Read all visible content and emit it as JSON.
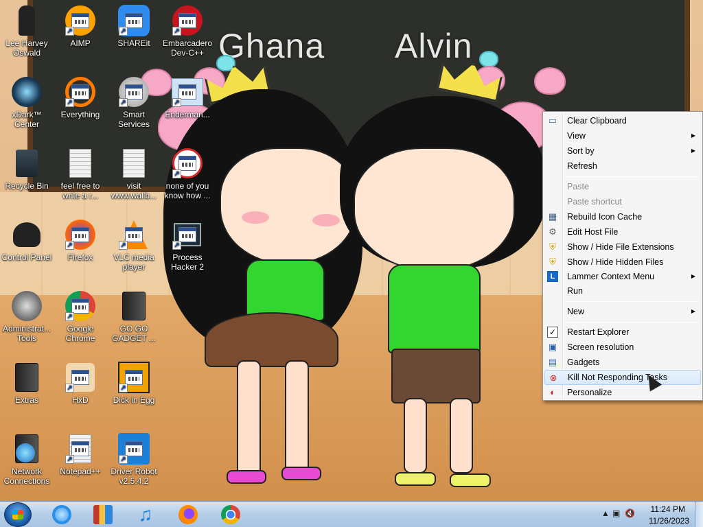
{
  "wallpaper": {
    "left_name": "Ghana",
    "right_name": "Alvin"
  },
  "desktop_icons": [
    {
      "label": "Lee Harvey Oswald",
      "icon": "character-icon"
    },
    {
      "label": "AIMP",
      "icon": "aimp-icon"
    },
    {
      "label": "SHAREit",
      "icon": "shareit-icon"
    },
    {
      "label": "Embarcadero Dev-C++",
      "icon": "devcpp-icon"
    },
    {
      "label": "xDark™ Center",
      "icon": "xdark-icon"
    },
    {
      "label": "Everything",
      "icon": "everything-icon"
    },
    {
      "label": "Smart Services",
      "icon": "smart-services-icon"
    },
    {
      "label": "Enderman...",
      "icon": "enderman-icon"
    },
    {
      "label": "Recycle Bin",
      "icon": "recycle-bin-icon"
    },
    {
      "label": "feel free to write a r...",
      "icon": "text-document-icon"
    },
    {
      "label": "visit www.wallb...",
      "icon": "text-document-icon"
    },
    {
      "label": "none of you know how ...",
      "icon": "shortcut-icon"
    },
    {
      "label": "Control Panel",
      "icon": "control-panel-icon"
    },
    {
      "label": "Firefox",
      "icon": "firefox-icon"
    },
    {
      "label": "VLC media player",
      "icon": "vlc-icon"
    },
    {
      "label": "Process Hacker 2",
      "icon": "process-hacker-icon"
    },
    {
      "label": "Administrat... Tools",
      "icon": "admin-tools-icon"
    },
    {
      "label": "Google Chrome",
      "icon": "chrome-icon"
    },
    {
      "label": "GO GO GADGET ...",
      "icon": "folder-icon"
    },
    {
      "label": "Extras",
      "icon": "folder-icon"
    },
    {
      "label": "HxD",
      "icon": "hxd-icon"
    },
    {
      "label": "Dick in Egg",
      "icon": "dick-in-egg-icon"
    },
    {
      "label": "Network Connections",
      "icon": "network-icon"
    },
    {
      "label": "Notepad++",
      "icon": "notepadpp-icon"
    },
    {
      "label": "Driver Robot v2.5.4.2",
      "icon": "driver-robot-icon"
    }
  ],
  "context_menu": {
    "items": [
      {
        "label": "Clear Clipboard",
        "icon": "clipboard-icon"
      },
      {
        "label": "View",
        "submenu": true
      },
      {
        "label": "Sort by",
        "submenu": true
      },
      {
        "label": "Refresh"
      },
      {
        "label": "Paste",
        "disabled": true
      },
      {
        "label": "Paste shortcut",
        "disabled": true
      },
      {
        "label": "Rebuild Icon Cache",
        "icon": "rebuild-cache-icon"
      },
      {
        "label": "Edit Host File",
        "icon": "gear-icon"
      },
      {
        "label": "Show / Hide File Extensions",
        "icon": "shield-icon"
      },
      {
        "label": "Show / Hide Hidden Files",
        "icon": "shield-icon"
      },
      {
        "label": "Lammer Context Menu",
        "icon": "lammer-icon",
        "submenu": true
      },
      {
        "label": "Run"
      },
      {
        "label": "New",
        "submenu": true
      },
      {
        "label": "Restart Explorer",
        "icon": "checkmark-icon"
      },
      {
        "label": "Screen resolution",
        "icon": "monitor-icon"
      },
      {
        "label": "Gadgets",
        "icon": "gadgets-icon"
      },
      {
        "label": "Kill Not Responding Tasks",
        "icon": "kill-task-icon",
        "hover": true
      },
      {
        "label": "Personalize",
        "icon": "personalize-icon"
      }
    ]
  },
  "taskbar": {
    "pinned": [
      {
        "name": "internet-explorer-icon"
      },
      {
        "name": "archive-icon"
      },
      {
        "name": "music-icon"
      },
      {
        "name": "firefox-icon"
      },
      {
        "name": "chrome-icon"
      }
    ],
    "clock_time": "11:24 PM",
    "clock_date": "11/26/2023"
  },
  "colors": {
    "taskbar": "#b5cfe8",
    "menu_bg": "#f5f5f5",
    "menu_hover": "#d9e9fa",
    "shirt_green": "#33d62f"
  }
}
